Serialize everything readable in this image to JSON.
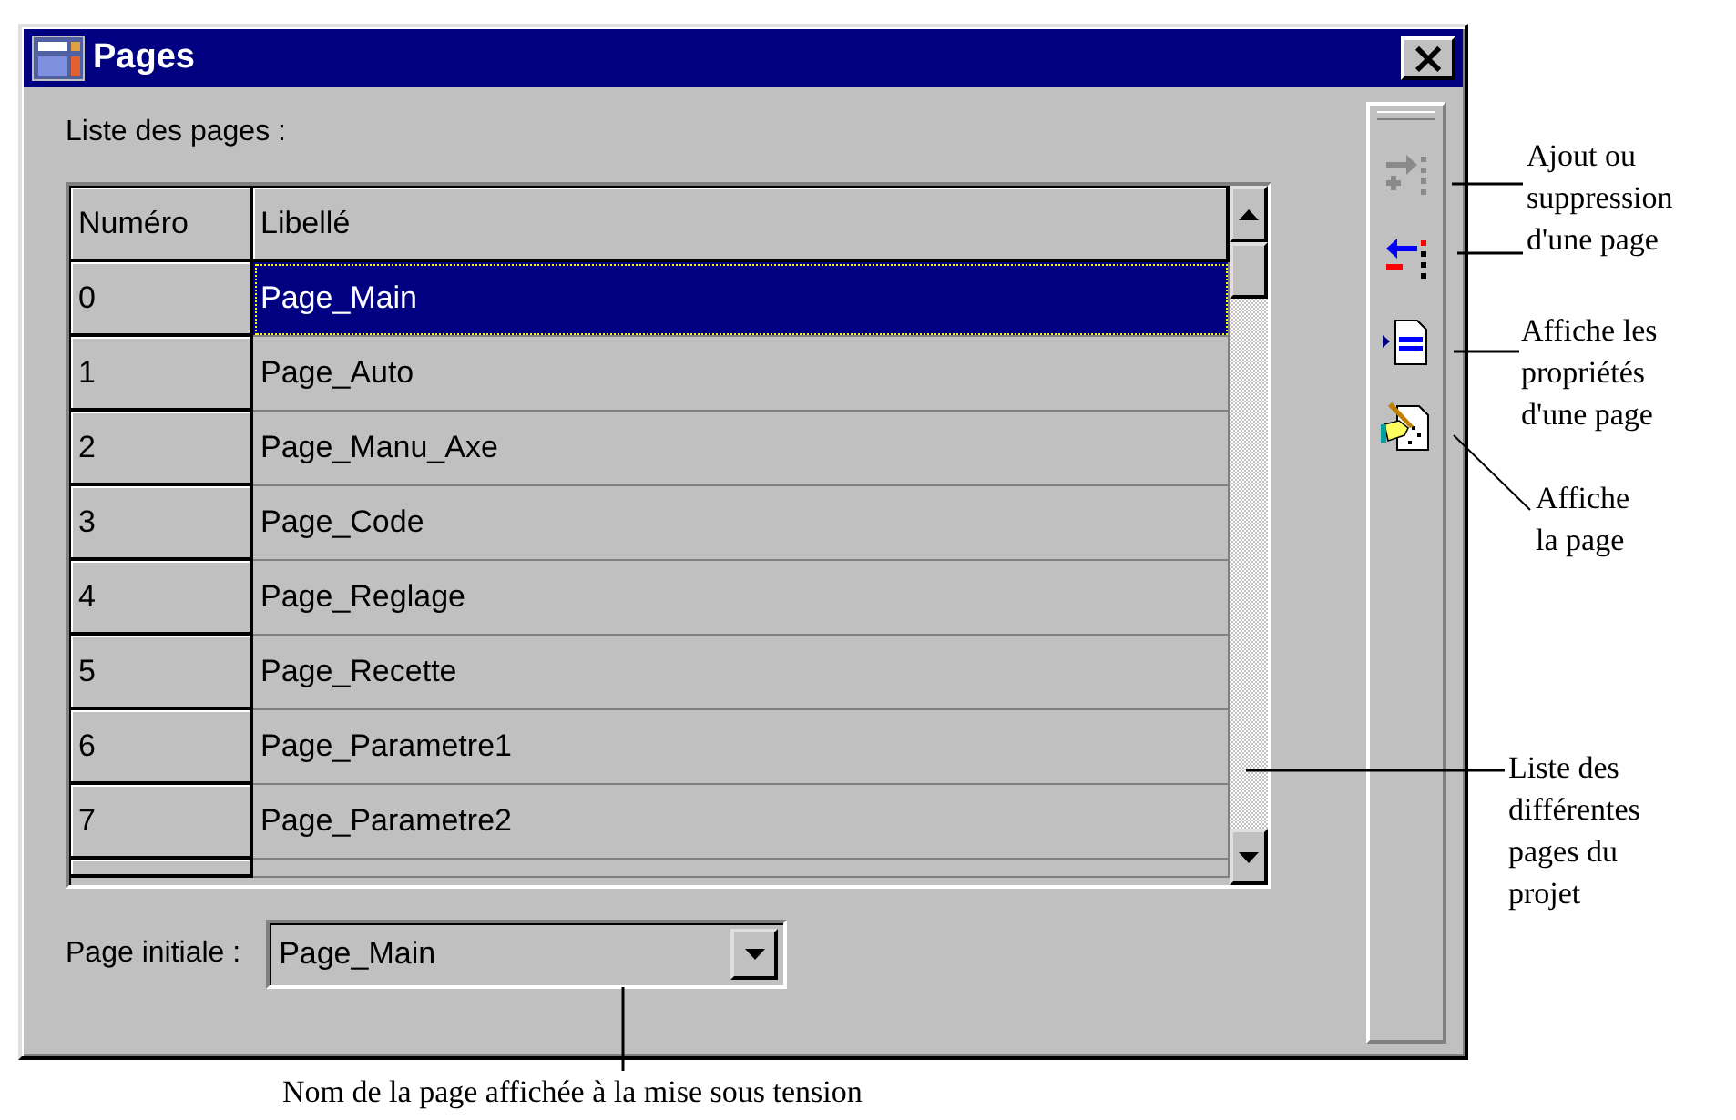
{
  "window": {
    "title": "Pages",
    "close": "×"
  },
  "list_label": "Liste des pages :",
  "table": {
    "columns": [
      "Numéro",
      "Libellé"
    ],
    "rows": [
      {
        "number": "0",
        "label": "Page_Main",
        "selected": true
      },
      {
        "number": "1",
        "label": "Page_Auto",
        "selected": false
      },
      {
        "number": "2",
        "label": "Page_Manu_Axe",
        "selected": false
      },
      {
        "number": "3",
        "label": "Page_Code",
        "selected": false
      },
      {
        "number": "4",
        "label": "Page_Reglage",
        "selected": false
      },
      {
        "number": "5",
        "label": "Page_Recette",
        "selected": false
      },
      {
        "number": "6",
        "label": "Page_Parametre1",
        "selected": false
      },
      {
        "number": "7",
        "label": "Page_Parametre2",
        "selected": false
      }
    ]
  },
  "initial_page": {
    "label": "Page initiale :",
    "value": "Page_Main"
  },
  "toolbar": [
    {
      "kind": "add",
      "disabled": true
    },
    {
      "kind": "remove",
      "disabled": false
    },
    {
      "kind": "properties",
      "disabled": false
    },
    {
      "kind": "show",
      "disabled": false
    }
  ],
  "annotations": [
    {
      "lines": [
        "Ajout ou",
        "suppression",
        "d'une page"
      ]
    },
    {
      "lines": [
        "Affiche les",
        "propriétés",
        "d'une page"
      ]
    },
    {
      "lines": [
        "Affiche",
        "la page"
      ]
    },
    {
      "lines": [
        "Liste des",
        "différentes",
        "pages du",
        "projet"
      ]
    },
    {
      "lines": [
        "Nom de la page affichée à la mise sous tension"
      ]
    }
  ]
}
